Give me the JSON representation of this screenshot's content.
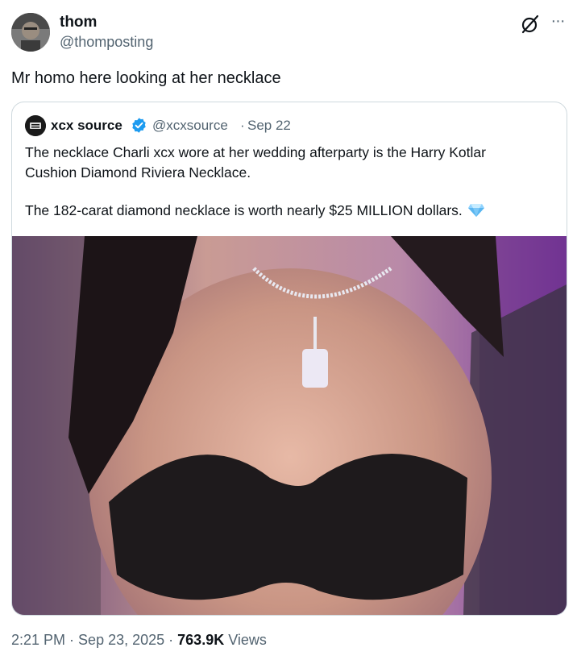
{
  "tweet": {
    "author_name": "thom",
    "author_handle": "@thomposting",
    "text": "Mr homo here looking at her necklace"
  },
  "quoted": {
    "author_name": "xcx source",
    "author_handle": "@xcxsource",
    "separator": "·",
    "date": "Sep 22",
    "verified": true,
    "text_line1": "The necklace Charli xcx wore at her wedding afterparty is the Harry Kotlar Cushion Diamond Riviera Necklace.",
    "text_line2": "The 182-carat diamond necklace is worth nearly $25 MILLION dollars."
  },
  "footer": {
    "time": "2:21 PM",
    "sep1": " · ",
    "date": "Sep 23, 2025",
    "sep2": " · ",
    "views_count": "763.9K",
    "views_label": " Views"
  },
  "icons": {
    "grok": "grok-icon",
    "more": "more-icon",
    "verified": "verified-badge-icon",
    "diamond": "gem-stone-emoji"
  },
  "colors": {
    "verified": "#1d9bf0",
    "secondary_text": "#536471",
    "primary_text": "#0f1419",
    "border": "#cfd9de"
  }
}
